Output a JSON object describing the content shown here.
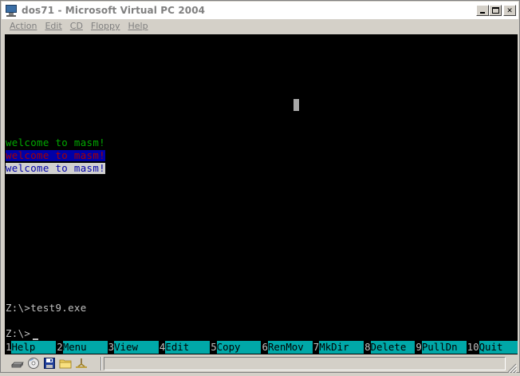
{
  "window": {
    "title": "dos71 - Microsoft Virtual PC 2004"
  },
  "menu": [
    {
      "label": "Action"
    },
    {
      "label": "Edit"
    },
    {
      "label": "CD"
    },
    {
      "label": "Floppy"
    },
    {
      "label": "Help"
    }
  ],
  "screen": {
    "lines": [
      {
        "text": "welcome to masm!",
        "fg": "#00a800",
        "bg": "#000000"
      },
      {
        "text": "welcome to masm!",
        "fg": "#a80000",
        "bg": "#0000a8"
      },
      {
        "text": "welcome to masm!",
        "fg": "#0000a8",
        "bg": "#d0d0d0"
      },
      {
        "text": "Z:\\>test9.exe",
        "fg": "#c0c0c0",
        "bg": "#000000"
      },
      {
        "text": "Z:\\>",
        "fg": "#c0c0c0",
        "bg": "#000000"
      }
    ]
  },
  "function_keys": [
    {
      "num": "1",
      "label": "Help"
    },
    {
      "num": "2",
      "label": "Menu"
    },
    {
      "num": "3",
      "label": "View"
    },
    {
      "num": "4",
      "label": "Edit"
    },
    {
      "num": "5",
      "label": "Copy"
    },
    {
      "num": "6",
      "label": "RenMov"
    },
    {
      "num": "7",
      "label": "MkDir"
    },
    {
      "num": "8",
      "label": "Delete"
    },
    {
      "num": "9",
      "label": "PullDn"
    },
    {
      "num": "10",
      "label": "Quit"
    }
  ],
  "status_icons": [
    "hard-disk-icon",
    "cd-drive-icon",
    "floppy-disk-icon",
    "shared-folder-icon",
    "network-icon"
  ],
  "colors": {
    "fkey_label_bg": "#00a8a8",
    "screen_bg": "#000000",
    "chrome": "#d4d0c8"
  }
}
